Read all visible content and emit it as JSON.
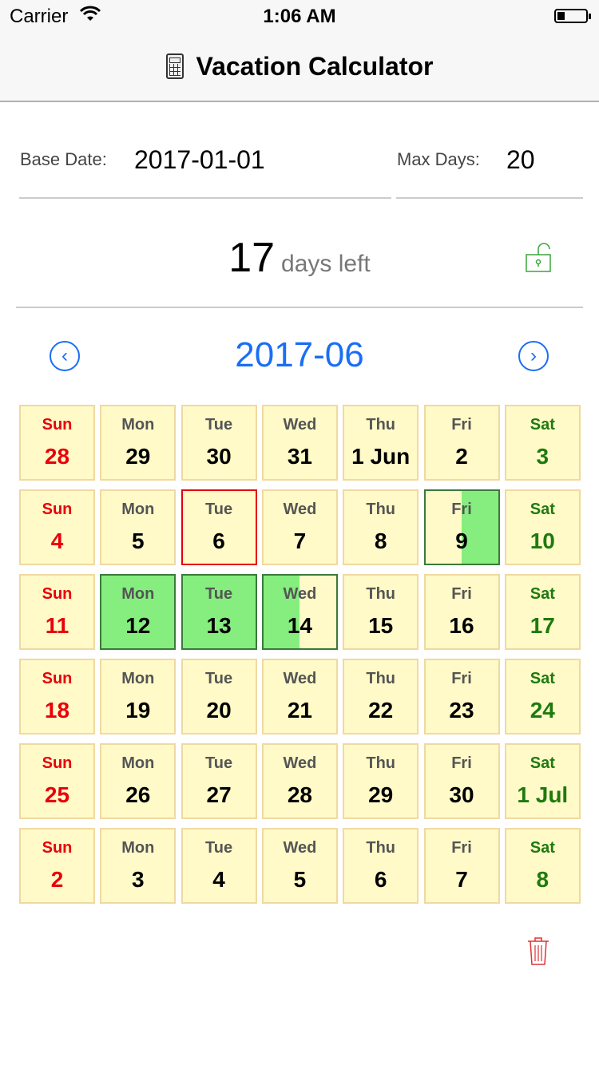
{
  "status": {
    "carrier": "Carrier",
    "time": "1:06 AM",
    "battery_level": 0.25
  },
  "nav": {
    "title": "Vacation Calculator",
    "icon": "calculator-icon"
  },
  "form": {
    "base_date_label": "Base Date:",
    "base_date": "2017-01-01",
    "max_days_label": "Max Days:",
    "max_days": "20"
  },
  "summary": {
    "days_left": "17",
    "days_left_label": "days left",
    "lock_icon": "unlocked-icon"
  },
  "calendar": {
    "month": "2017-06",
    "colors": {
      "cell": "#fffac8",
      "border": "#f0d9a0",
      "vacation": "#85ee7e",
      "sunday": "#e8000b",
      "saturday": "#1e7a0e",
      "accent": "#1a6ef5"
    },
    "weeks": [
      [
        {
          "wd": "Sun",
          "d": "28"
        },
        {
          "wd": "Mon",
          "d": "29"
        },
        {
          "wd": "Tue",
          "d": "30"
        },
        {
          "wd": "Wed",
          "d": "31"
        },
        {
          "wd": "Thu",
          "d": "1 Jun"
        },
        {
          "wd": "Fri",
          "d": "2"
        },
        {
          "wd": "Sat",
          "d": "3"
        }
      ],
      [
        {
          "wd": "Sun",
          "d": "4"
        },
        {
          "wd": "Mon",
          "d": "5"
        },
        {
          "wd": "Tue",
          "d": "6",
          "today": true
        },
        {
          "wd": "Wed",
          "d": "7"
        },
        {
          "wd": "Thu",
          "d": "8"
        },
        {
          "wd": "Fri",
          "d": "9",
          "vacation": "pm"
        },
        {
          "wd": "Sat",
          "d": "10"
        }
      ],
      [
        {
          "wd": "Sun",
          "d": "11"
        },
        {
          "wd": "Mon",
          "d": "12",
          "vacation": "full"
        },
        {
          "wd": "Tue",
          "d": "13",
          "vacation": "full"
        },
        {
          "wd": "Wed",
          "d": "14",
          "vacation": "am"
        },
        {
          "wd": "Thu",
          "d": "15"
        },
        {
          "wd": "Fri",
          "d": "16"
        },
        {
          "wd": "Sat",
          "d": "17"
        }
      ],
      [
        {
          "wd": "Sun",
          "d": "18"
        },
        {
          "wd": "Mon",
          "d": "19"
        },
        {
          "wd": "Tue",
          "d": "20"
        },
        {
          "wd": "Wed",
          "d": "21"
        },
        {
          "wd": "Thu",
          "d": "22"
        },
        {
          "wd": "Fri",
          "d": "23"
        },
        {
          "wd": "Sat",
          "d": "24"
        }
      ],
      [
        {
          "wd": "Sun",
          "d": "25"
        },
        {
          "wd": "Mon",
          "d": "26"
        },
        {
          "wd": "Tue",
          "d": "27"
        },
        {
          "wd": "Wed",
          "d": "28"
        },
        {
          "wd": "Thu",
          "d": "29"
        },
        {
          "wd": "Fri",
          "d": "30"
        },
        {
          "wd": "Sat",
          "d": "1 Jul"
        }
      ],
      [
        {
          "wd": "Sun",
          "d": "2"
        },
        {
          "wd": "Mon",
          "d": "3"
        },
        {
          "wd": "Tue",
          "d": "4"
        },
        {
          "wd": "Wed",
          "d": "5"
        },
        {
          "wd": "Thu",
          "d": "6"
        },
        {
          "wd": "Fri",
          "d": "7"
        },
        {
          "wd": "Sat",
          "d": "8"
        }
      ]
    ]
  },
  "actions": {
    "trash_icon": "trash-icon"
  }
}
